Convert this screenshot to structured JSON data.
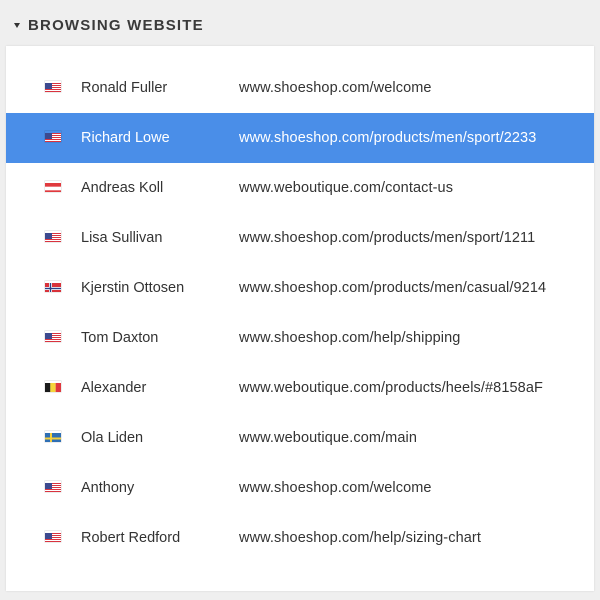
{
  "section": {
    "title": "BROWSING WEBSITE",
    "collapse_icon": "caret-down-icon"
  },
  "colors": {
    "selected_row": "#4a8ee8",
    "background": "#efefef",
    "panel": "#ffffff"
  },
  "visitors": [
    {
      "name": "Ronald Fuller",
      "url": "www.shoeshop.com/welcome",
      "flag": "us",
      "flag_icon": "us-flag-icon",
      "selected": false
    },
    {
      "name": "Richard Lowe",
      "url": "www.shoeshop.com/products/men/sport/2233",
      "flag": "us",
      "flag_icon": "us-flag-icon",
      "selected": true
    },
    {
      "name": "Andreas Koll",
      "url": "www.weboutique.com/contact-us",
      "flag": "at",
      "flag_icon": "austria-flag-icon",
      "selected": false
    },
    {
      "name": "Lisa Sullivan",
      "url": "www.shoeshop.com/products/men/sport/1211",
      "flag": "us",
      "flag_icon": "us-flag-icon",
      "selected": false
    },
    {
      "name": "Kjerstin Ottosen",
      "url": "www.shoeshop.com/products/men/casual/9214",
      "flag": "no",
      "flag_icon": "norway-flag-icon",
      "selected": false
    },
    {
      "name": "Tom Daxton",
      "url": "www.shoeshop.com/help/shipping",
      "flag": "us",
      "flag_icon": "us-flag-icon",
      "selected": false
    },
    {
      "name": "Alexander",
      "url": "www.weboutique.com/products/heels/#8158aF",
      "flag": "be",
      "flag_icon": "belgium-flag-icon",
      "selected": false
    },
    {
      "name": "Ola Liden",
      "url": "www.weboutique.com/main",
      "flag": "se",
      "flag_icon": "sweden-flag-icon",
      "selected": false
    },
    {
      "name": "Anthony",
      "url": "www.shoeshop.com/welcome",
      "flag": "us",
      "flag_icon": "us-flag-icon",
      "selected": false
    },
    {
      "name": "Robert Redford",
      "url": "www.shoeshop.com/help/sizing-chart",
      "flag": "us",
      "flag_icon": "us-flag-icon",
      "selected": false
    }
  ]
}
